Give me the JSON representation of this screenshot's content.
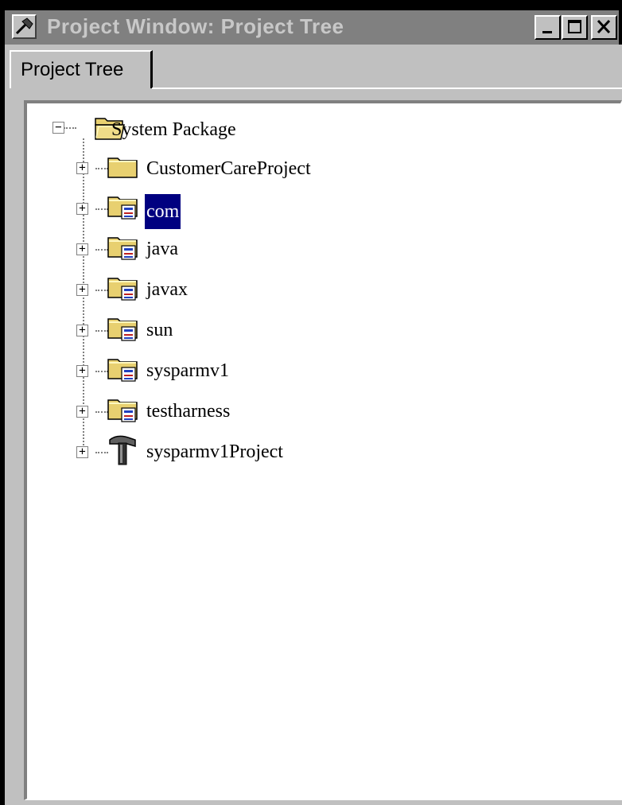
{
  "window": {
    "title": "Project Window: Project Tree",
    "icon": "hammer-icon",
    "controls": [
      "minimize-icon",
      "maximize-icon",
      "close-icon"
    ]
  },
  "tabs": [
    {
      "label": "Project Tree",
      "active": true
    }
  ],
  "tree": {
    "root": {
      "label": "System Package",
      "icon": "open-folder-icon",
      "expanded": true
    },
    "children": [
      {
        "label": "CustomerCareProject",
        "icon": "folder-icon",
        "selected": false
      },
      {
        "label": "com",
        "icon": "package-folder-icon",
        "selected": true
      },
      {
        "label": "java",
        "icon": "package-folder-icon",
        "selected": false
      },
      {
        "label": "javax",
        "icon": "package-folder-icon",
        "selected": false
      },
      {
        "label": "sun",
        "icon": "package-folder-icon",
        "selected": false
      },
      {
        "label": "sysparmv1",
        "icon": "package-folder-icon",
        "selected": false
      },
      {
        "label": "testharness",
        "icon": "package-folder-icon",
        "selected": false
      },
      {
        "label": "sysparmv1Project",
        "icon": "hammer-icon",
        "selected": false
      }
    ]
  },
  "colors": {
    "selection": "#000080",
    "title_bar": "#808080",
    "face": "#c0c0c0"
  }
}
